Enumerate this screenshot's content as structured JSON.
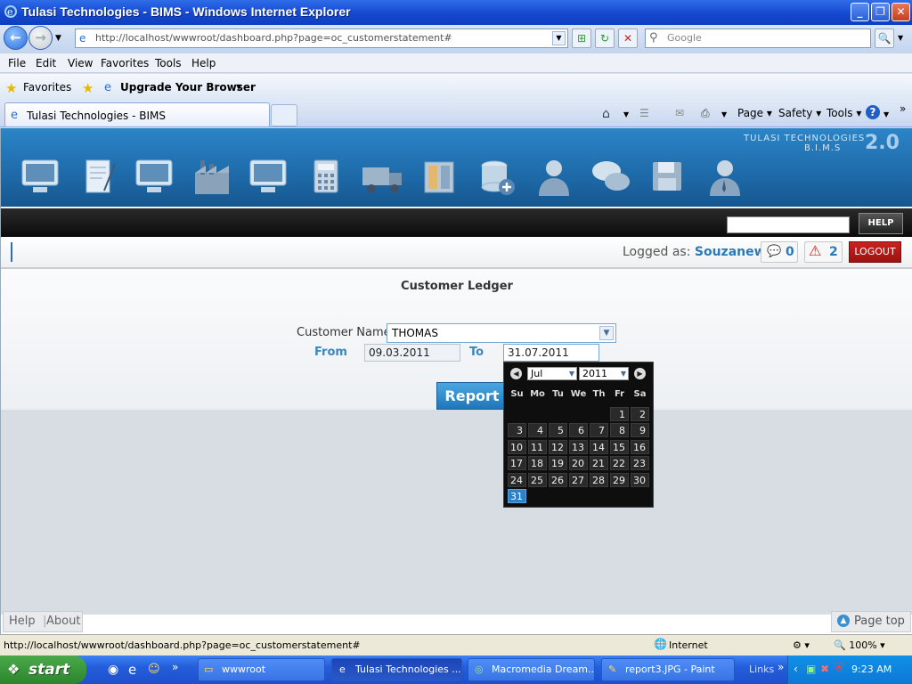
{
  "window": {
    "title": "Tulasi Technologies - BIMS - Windows Internet Explorer"
  },
  "addressbar": {
    "url": "http://localhost/wwwroot/dashboard.php?page=oc_customerstatement#",
    "search_placeholder": "Google"
  },
  "menu": [
    "File",
    "Edit",
    "View",
    "Favorites",
    "Tools",
    "Help"
  ],
  "favbar": {
    "favorites": "Favorites",
    "upgrade": "Upgrade Your Browser"
  },
  "tab": {
    "title": "Tulasi Technologies - BIMS"
  },
  "commandbar": {
    "page": "Page",
    "safety": "Safety",
    "tools": "Tools"
  },
  "app": {
    "brand_line1": "TULASI TECHNOLOGIES",
    "brand_line2": "B.I.M.S",
    "brand_version": "2.0",
    "help_button": "HELP",
    "logged_prefix": "Logged as:",
    "user": "Souzanew",
    "messages_count": "0",
    "alerts_count": "2",
    "logout": "LOGOUT"
  },
  "form": {
    "title": "Customer Ledger",
    "customer_label": "Customer Name",
    "customer_value": "THOMAS",
    "from_label": "From",
    "from_value": "09.03.2011",
    "to_label": "To",
    "to_value": "31.07.2011",
    "report_button": "Report"
  },
  "calendar": {
    "month": "Jul",
    "year": "2011",
    "dow": [
      "Su",
      "Mo",
      "Tu",
      "We",
      "Th",
      "Fr",
      "Sa"
    ],
    "weeks": [
      [
        "",
        "",
        "",
        "",
        "",
        "1",
        "2"
      ],
      [
        "3",
        "4",
        "5",
        "6",
        "7",
        "8",
        "9"
      ],
      [
        "10",
        "11",
        "12",
        "13",
        "14",
        "15",
        "16"
      ],
      [
        "17",
        "18",
        "19",
        "20",
        "21",
        "22",
        "23"
      ],
      [
        "24",
        "25",
        "26",
        "27",
        "28",
        "29",
        "30"
      ],
      [
        "31",
        "",
        "",
        "",
        "",
        "",
        ""
      ]
    ],
    "selected": "31"
  },
  "footer": {
    "help": "Help",
    "about": "About",
    "page_top": "Page top"
  },
  "statusbar": {
    "url": "http://localhost/wwwroot/dashboard.php?page=oc_customerstatement#",
    "zone": "Internet",
    "zoom": "100%"
  },
  "taskbar": {
    "start": "start",
    "tasks": [
      "wwwroot",
      "Tulasi Technologies ...",
      "Macromedia Dream...",
      "report3.JPG - Paint"
    ],
    "links": "Links",
    "clock": "9:23 AM"
  }
}
